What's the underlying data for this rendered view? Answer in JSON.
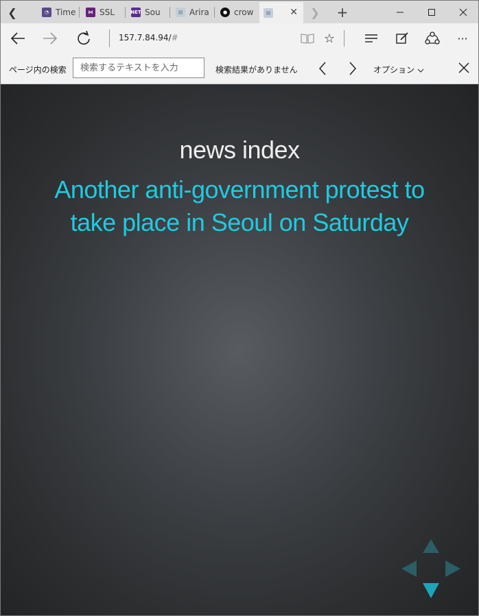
{
  "tabs": [
    {
      "title": "Time",
      "icon": "time-favicon",
      "color": "#5b4a8a"
    },
    {
      "title": "SSL",
      "icon": "visual-studio-favicon",
      "color": "#68217a"
    },
    {
      "title": "Sou",
      "icon": "dotnet-favicon",
      "color": "#5c2d91"
    },
    {
      "title": "Arira",
      "icon": "page-favicon",
      "color": "#8899aa"
    },
    {
      "title": "crow",
      "icon": "github-favicon",
      "color": "#111111"
    },
    {
      "title": "",
      "icon": "page-favicon",
      "color": "#8899aa",
      "active": true
    }
  ],
  "address": {
    "host": "157.7.84.94/",
    "hash": "#"
  },
  "find": {
    "label": "ページ内の検索",
    "placeholder": "検索するテキストを入力",
    "status": "検索結果がありません",
    "options": "オプション"
  },
  "page": {
    "title": "news index",
    "headline": "Another anti-government protest to take place in Seoul on Saturday"
  },
  "colors": {
    "accent": "#1ecbe1",
    "title": "#eeeeee"
  }
}
